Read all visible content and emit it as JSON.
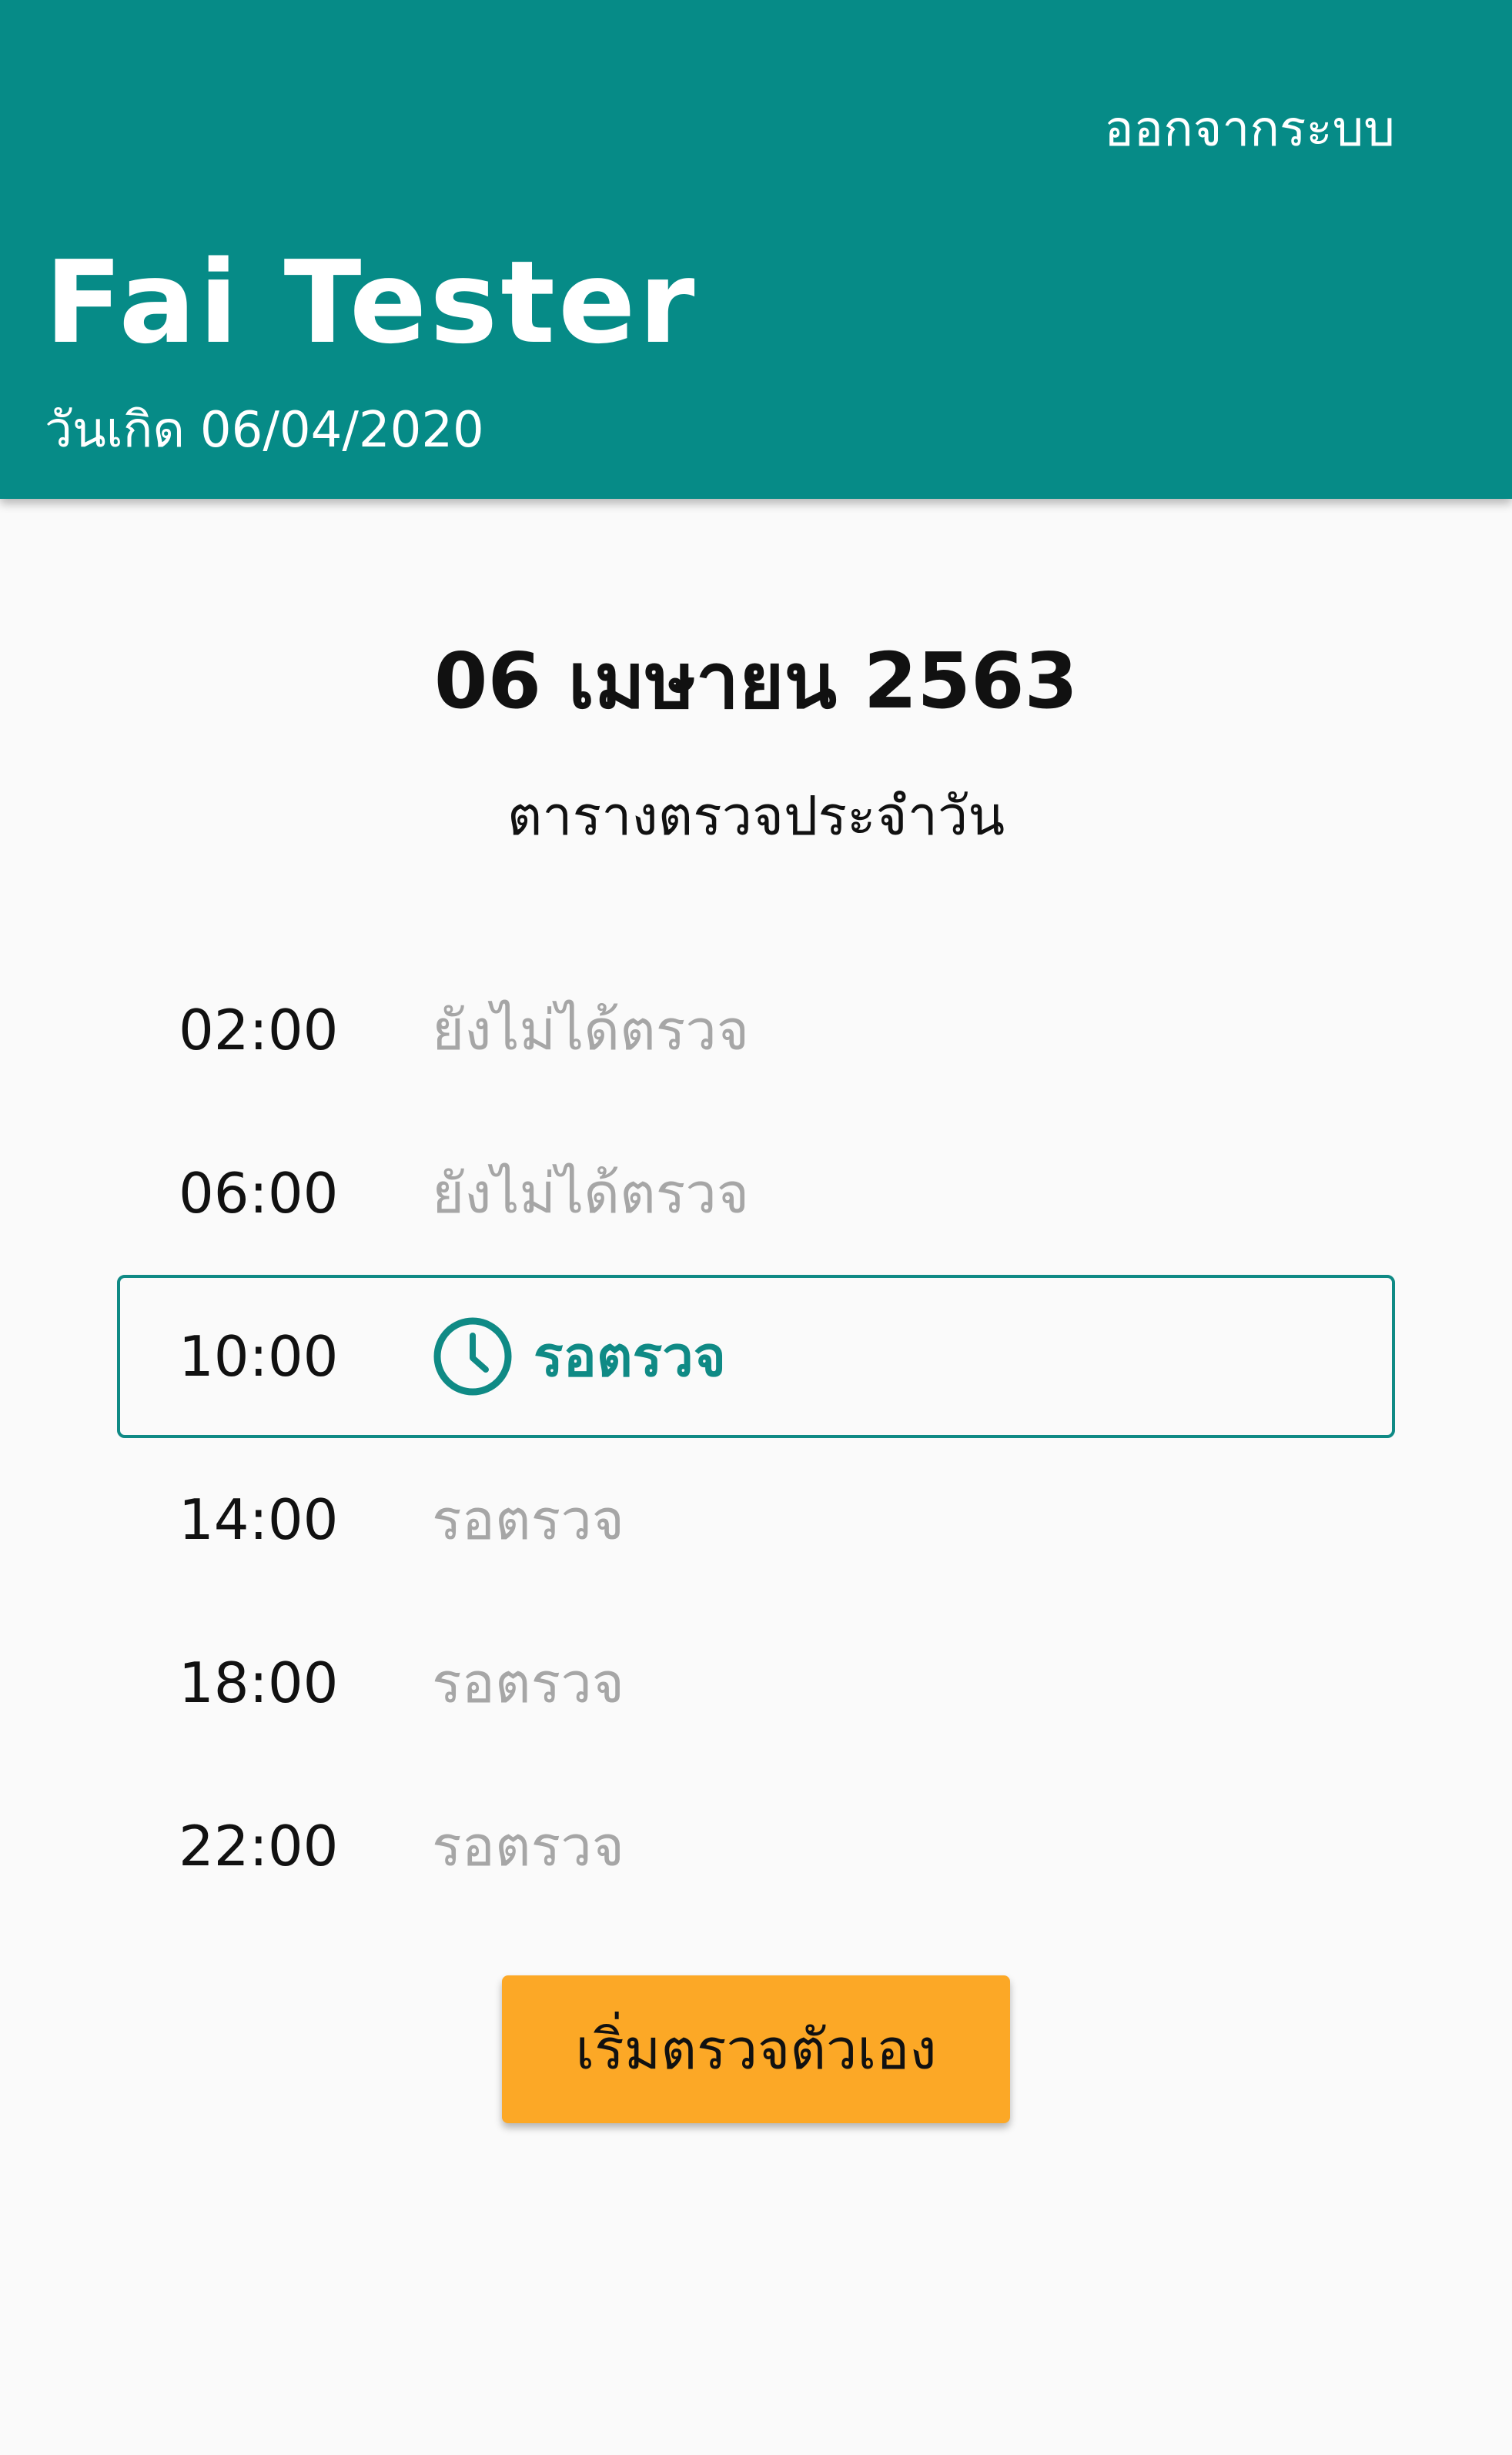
{
  "header": {
    "logout_label": "ออกจากระบบ",
    "user_name": "Fai Tester",
    "birth_label": "วันเกิด",
    "birth_date": "06/04/2020",
    "background_color": "#068b87"
  },
  "main": {
    "date_title": "06 เมษายน 2563",
    "subtitle": "ตารางตรวจประจำวัน",
    "schedule": [
      {
        "time": "02:00",
        "status": "ยังไม่ได้ตรวจ",
        "active": false
      },
      {
        "time": "06:00",
        "status": "ยังไม่ได้ตรวจ",
        "active": false
      },
      {
        "time": "10:00",
        "status": "รอตรวจ",
        "active": true,
        "icon": "clock-icon"
      },
      {
        "time": "14:00",
        "status": "รอตรวจ",
        "active": false
      },
      {
        "time": "18:00",
        "status": "รอตรวจ",
        "active": false
      },
      {
        "time": "22:00",
        "status": "รอตรวจ",
        "active": false
      }
    ],
    "start_button_label": "เริ่มตรวจตัวเอง",
    "accent_color": "#0f8a85",
    "button_color": "#fca826"
  }
}
